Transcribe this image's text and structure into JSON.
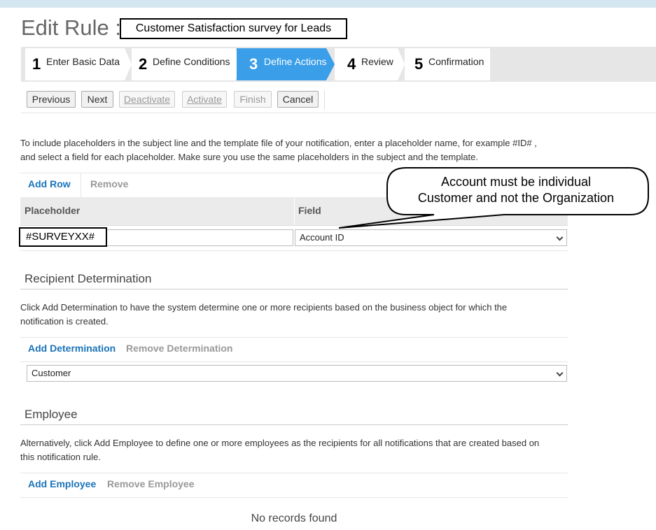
{
  "page": {
    "title": "Edit Rule :",
    "rule_name": "Customer Satisfaction survey for Leads"
  },
  "wizard": {
    "steps": [
      {
        "num": "1",
        "label": "Enter Basic Data"
      },
      {
        "num": "2",
        "label": "Define Conditions"
      },
      {
        "num": "3",
        "label": "Define Actions"
      },
      {
        "num": "4",
        "label": "Review"
      },
      {
        "num": "5",
        "label": "Confirmation"
      }
    ],
    "active_step": "3"
  },
  "toolbar": {
    "previous": "Previous",
    "next": "Next",
    "deactivate": "Deactivate",
    "activate": "Activate",
    "finish": "Finish",
    "cancel": "Cancel"
  },
  "placeholders": {
    "instructions_line1": "To include placeholders in the subject line and the template file of your notification, enter a placeholder name, for example #ID# ,",
    "instructions_line2": "and select a field for each placeholder. Make sure you use the same placeholders in the subject and the template.",
    "add_row": "Add Row",
    "remove": "Remove",
    "col_placeholder": "Placeholder",
    "col_field": "Field",
    "row": {
      "placeholder": "#SURVEYXX#",
      "field": "Account ID"
    }
  },
  "annotation": {
    "line1": "Account must be individual",
    "line2": "Customer and not the Organization"
  },
  "recipient": {
    "title": "Recipient Determination",
    "text_line1": "Click Add Determination to have the system determine one or more recipients based on the business object for which the",
    "text_line2": "notification is created.",
    "add": "Add Determination",
    "remove": "Remove Determination",
    "value": "Customer"
  },
  "employee": {
    "title": "Employee",
    "text_line1": "Alternatively, click Add Employee to define one or more employees as the recipients for all notifications that are created based on",
    "text_line2": "this notification rule.",
    "add": "Add Employee",
    "remove": "Remove Employee",
    "empty": "No records found"
  },
  "colors": {
    "active_step": "#3a9ee8",
    "link_blue": "#1a73ba",
    "disabled": "#999999"
  }
}
